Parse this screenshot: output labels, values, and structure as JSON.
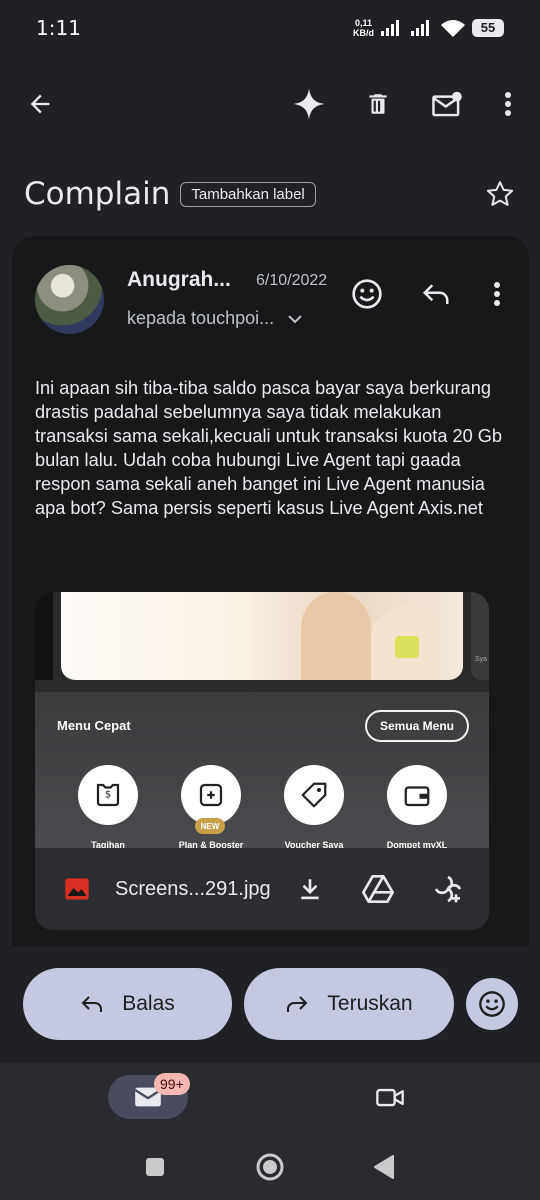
{
  "status_bar": {
    "time": "1:11",
    "net_speed_value": "0,11",
    "net_speed_unit": "KB/d",
    "battery": "55",
    "wifi_label": "6"
  },
  "toolbar": {
    "back_icon": "arrow-left-icon",
    "gemini_icon": "sparkle-icon",
    "delete_icon": "trash-icon",
    "unread_icon": "mail-unread-icon",
    "more_icon": "more-vertical-icon"
  },
  "subject": {
    "title": "Complain",
    "label_chip": "Tambahkan label"
  },
  "message": {
    "sender": "Anugrah...",
    "date": "6/10/2022",
    "recipient": "kepada touchpoi...",
    "body": "Ini apaan sih tiba-tiba saldo pasca bayar saya berkurang drastis padahal sebelumnya saya tidak melakukan transaksi sama sekali,kecuali untuk transaksi kuota 20 Gb bulan lalu. Udah coba hubungi Live Agent tapi gaada respon sama sekali aneh banget ini Live Agent manusia apa bot? Sama persis seperti kasus Live Agent Axis.net"
  },
  "attachment": {
    "file_name": "Screens...291.jpg",
    "side_text": "Sya",
    "menu_title": "Menu Cepat",
    "menu_all": "Semua Menu",
    "new_badge": "NEW",
    "quick_items": [
      {
        "label": "Tagihan",
        "icon": "bill-icon"
      },
      {
        "label": "Plan & Booster",
        "icon": "plan-icon"
      },
      {
        "label": "Voucher Saya",
        "icon": "voucher-icon"
      },
      {
        "label": "Dompet myXL",
        "icon": "wallet-icon"
      }
    ]
  },
  "actions": {
    "reply_label": "Balas",
    "forward_label": "Teruskan"
  },
  "bottom_nav": {
    "mail_badge": "99+"
  },
  "colors": {
    "background": "#202124",
    "card": "#17181a",
    "pill": "#c4c8e0",
    "badge": "#f4b6b0"
  }
}
